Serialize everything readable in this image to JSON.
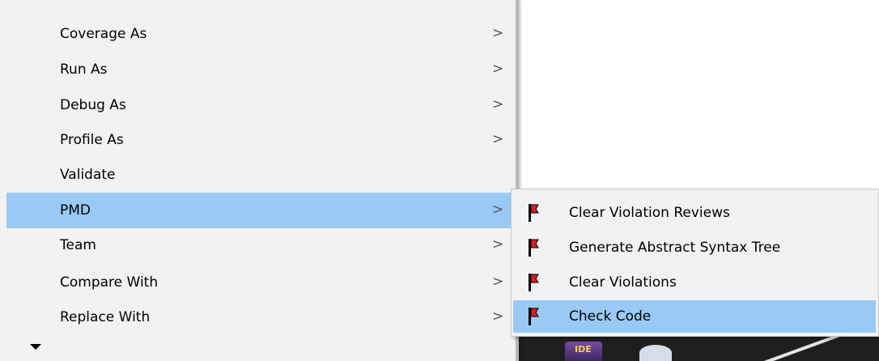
{
  "context_menu": {
    "items": [
      {
        "label": "Coverage As",
        "has_submenu": true
      },
      {
        "label": "Run As",
        "has_submenu": true
      },
      {
        "label": "Debug As",
        "has_submenu": true
      },
      {
        "label": "Profile As",
        "has_submenu": true
      },
      {
        "label": "Validate",
        "has_submenu": false
      },
      {
        "label": "PMD",
        "has_submenu": true,
        "selected": true
      },
      {
        "label": "Team",
        "has_submenu": true
      },
      {
        "label": "Compare With",
        "has_submenu": true
      },
      {
        "label": "Replace With",
        "has_submenu": true
      }
    ],
    "chevron": ">"
  },
  "pmd_submenu": {
    "items": [
      {
        "label": "Clear Violation Reviews",
        "icon": "pmd-flag-icon"
      },
      {
        "label": "Generate Abstract Syntax Tree",
        "icon": "pmd-flag-icon"
      },
      {
        "label": "Clear Violations",
        "icon": "pmd-flag-icon"
      },
      {
        "label": "Check Code",
        "icon": "pmd-flag-icon",
        "selected": true
      }
    ]
  },
  "colors": {
    "menu_background": "#f2f2f2",
    "selection": "#99c9f5",
    "pmd_flag_red": "#e0191e"
  }
}
